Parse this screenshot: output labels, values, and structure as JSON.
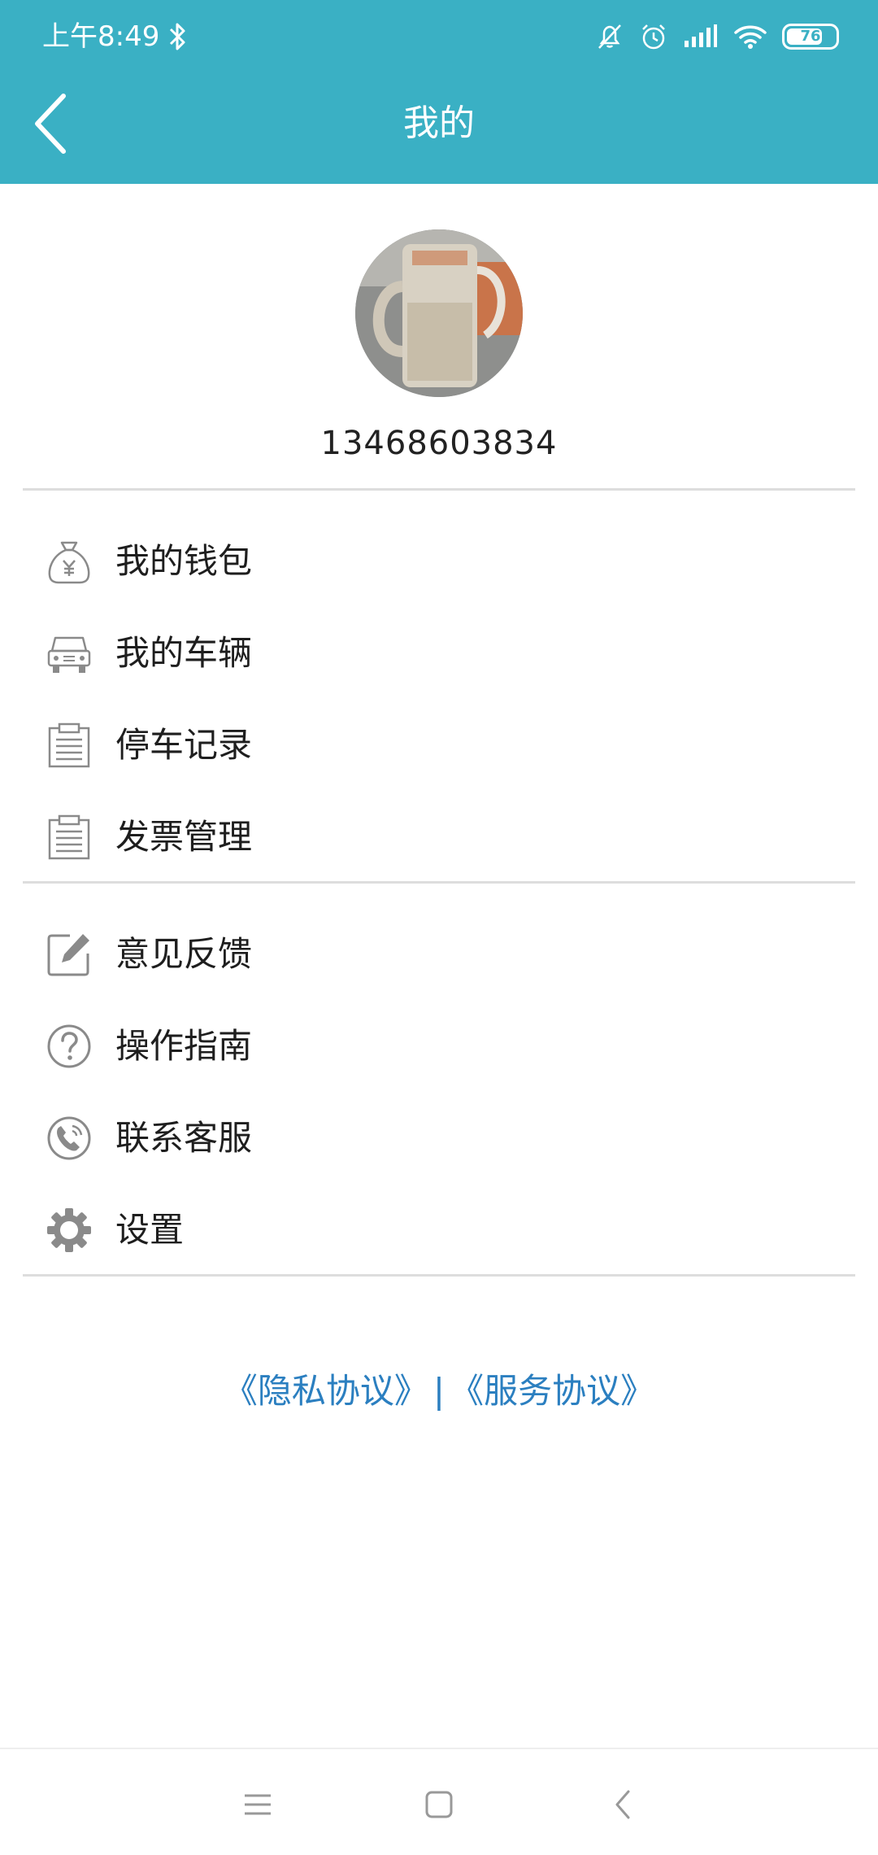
{
  "status_bar": {
    "time": "上午8:49",
    "battery_level": "76",
    "icons": [
      "bluetooth-icon",
      "mute-icon",
      "alarm-icon",
      "signal-icon",
      "wifi-icon",
      "battery-icon"
    ]
  },
  "header": {
    "title": "我的",
    "back_icon": "back-arrow-icon",
    "background_color": "#3ab0c4"
  },
  "profile": {
    "avatar_description": "avatar-image",
    "phone": "13468603834"
  },
  "menu_groups": [
    [
      {
        "label": "我的钱包",
        "icon": "wallet-icon"
      },
      {
        "label": "我的车辆",
        "icon": "car-icon"
      },
      {
        "label": "停车记录",
        "icon": "clipboard-icon"
      },
      {
        "label": "发票管理",
        "icon": "clipboard-icon"
      }
    ],
    [
      {
        "label": "意见反馈",
        "icon": "edit-icon"
      },
      {
        "label": "操作指南",
        "icon": "help-icon"
      },
      {
        "label": "联系客服",
        "icon": "phone-icon"
      },
      {
        "label": "设置",
        "icon": "gear-icon"
      }
    ]
  ],
  "links": {
    "privacy": "《隐私协议》",
    "separator": "|",
    "service": "《服务协议》",
    "color": "#2b7fc0"
  },
  "nav_bar": {
    "icons": [
      "menu-icon",
      "home-icon",
      "back-icon"
    ]
  }
}
